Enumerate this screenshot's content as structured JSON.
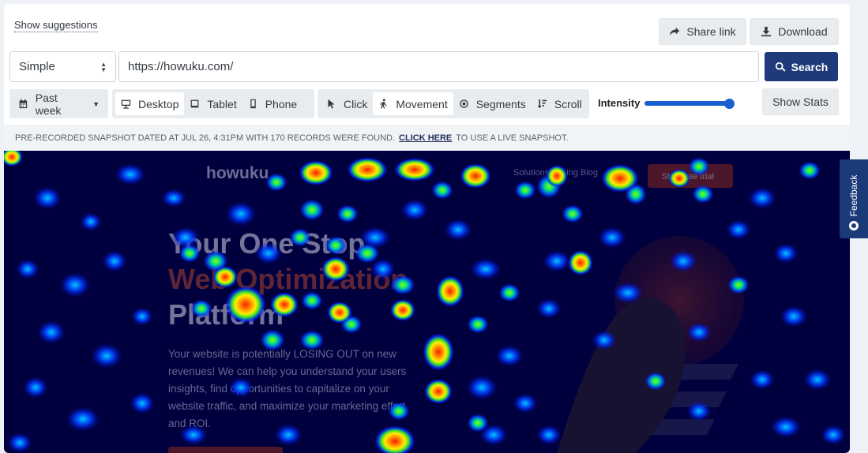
{
  "toolbar": {
    "suggestions_link": "Show suggestions",
    "share_label": "Share link",
    "download_label": "Download"
  },
  "search": {
    "mode_selected": "Simple",
    "url_value": "https://howuku.com/",
    "button_label": "Search"
  },
  "filters": {
    "date_range": "Past week",
    "devices": [
      "Desktop",
      "Tablet",
      "Phone"
    ],
    "device_selected": "Desktop",
    "views": [
      "Click",
      "Movement",
      "Segments",
      "Scroll"
    ],
    "view_selected": "Movement",
    "intensity_label": "Intensity",
    "intensity_value": 1.0,
    "stats_label": "Show Stats"
  },
  "notice": {
    "text": "Pre-recorded snapshot dated at Jul 26, 4:31PM with 170 records were found.",
    "link_label": "Click here",
    "suffix": "to use a live snapshot."
  },
  "background_page": {
    "logo": "howuku",
    "hero_lines": [
      "Your One Stop",
      "Web Optimization",
      "Platform"
    ],
    "body_lines": [
      "Your website is potentially LOSING OUT on new",
      "revenues! We can help you understand your users",
      "insights, find opportunities to capitalize on your",
      "website traffic, and maximize your marketing effort",
      "and ROI."
    ],
    "nav_hint": "Solutions Pricing Blog",
    "cta": "Start free trial"
  },
  "feedback_tab": "Feedback",
  "colors": {
    "primary": "#1f3a7a",
    "feedback_bg": "#1b3a78",
    "slider": "#1a5fd0",
    "heatmap_bg": "#00004a"
  }
}
